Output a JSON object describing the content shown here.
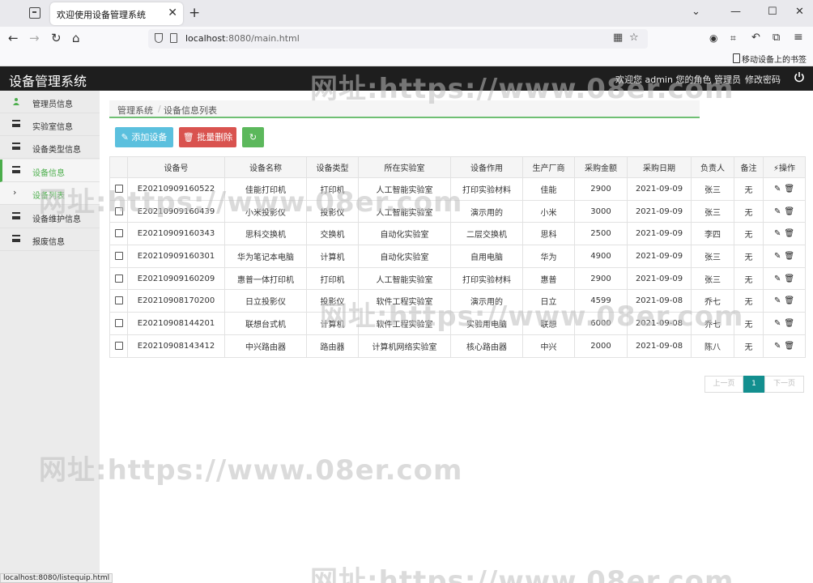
{
  "browser": {
    "tab_title": "欢迎使用设备管理系统",
    "url_host": "localhost",
    "url_rest": ":8080/main.html",
    "bookmark": "移动设备上的书签",
    "status_url": "localhost:8080/listequip.html"
  },
  "header": {
    "title": "设备管理系统",
    "welcome": "欢迎您 admin 您的角色 管理员",
    "change_password": "修改密码"
  },
  "sidebar": {
    "items": [
      {
        "label": "管理员信息",
        "icon": "user-group-icon"
      },
      {
        "label": "实验室信息",
        "icon": "list-icon"
      },
      {
        "label": "设备类型信息",
        "icon": "list-icon"
      },
      {
        "label": "设备信息",
        "icon": "list-icon"
      },
      {
        "label": "设备列表",
        "icon": "chevron-right-icon"
      },
      {
        "label": "设备维护信息",
        "icon": "list-icon"
      },
      {
        "label": "报废信息",
        "icon": "list-icon"
      }
    ]
  },
  "breadcrumb": [
    "管理系统",
    "设备信息列表"
  ],
  "toolbar": {
    "add_label": "添加设备",
    "delete_label": "批量删除"
  },
  "table": {
    "headers": [
      "设备号",
      "设备名称",
      "设备类型",
      "所在实验室",
      "设备作用",
      "生产厂商",
      "采购金额",
      "采购日期",
      "负责人",
      "备注",
      "操作"
    ],
    "rows": [
      [
        "E20210909160522",
        "佳能打印机",
        "打印机",
        "人工智能实验室",
        "打印实验材料",
        "佳能",
        "2900",
        "2021-09-09",
        "张三",
        "无"
      ],
      [
        "E20210909160439",
        "小米投影仪",
        "投影仪",
        "人工智能实验室",
        "演示用的",
        "小米",
        "3000",
        "2021-09-09",
        "张三",
        "无"
      ],
      [
        "E20210909160343",
        "思科交换机",
        "交换机",
        "自动化实验室",
        "二层交换机",
        "思科",
        "2500",
        "2021-09-09",
        "李四",
        "无"
      ],
      [
        "E20210909160301",
        "华为笔记本电脑",
        "计算机",
        "自动化实验室",
        "自用电脑",
        "华为",
        "4900",
        "2021-09-09",
        "张三",
        "无"
      ],
      [
        "E20210909160209",
        "惠普一体打印机",
        "打印机",
        "人工智能实验室",
        "打印实验材料",
        "惠普",
        "2900",
        "2021-09-09",
        "张三",
        "无"
      ],
      [
        "E20210908170200",
        "日立投影仪",
        "投影仪",
        "软件工程实验室",
        "演示用的",
        "日立",
        "4599",
        "2021-09-08",
        "乔七",
        "无"
      ],
      [
        "E20210908144201",
        "联想台式机",
        "计算机",
        "软件工程实验室",
        "实验用电脑",
        "联想",
        "6000",
        "2021-09-08",
        "乔七",
        "无"
      ],
      [
        "E20210908143412",
        "中兴路由器",
        "路由器",
        "计算机网络实验室",
        "核心路由器",
        "中兴",
        "2000",
        "2021-09-08",
        "陈八",
        "无"
      ]
    ]
  },
  "pagination": {
    "prev": "上一页",
    "current": "1",
    "next": "下一页"
  },
  "watermark": "网址:https://www.08er.com",
  "colors": {
    "accent_green": "#4cae4c",
    "btn_add": "#5bc0de",
    "btn_delete": "#d9534f",
    "btn_refresh": "#5cb85c",
    "page_active": "#138f8f",
    "header_bg": "#1e1e1e"
  }
}
